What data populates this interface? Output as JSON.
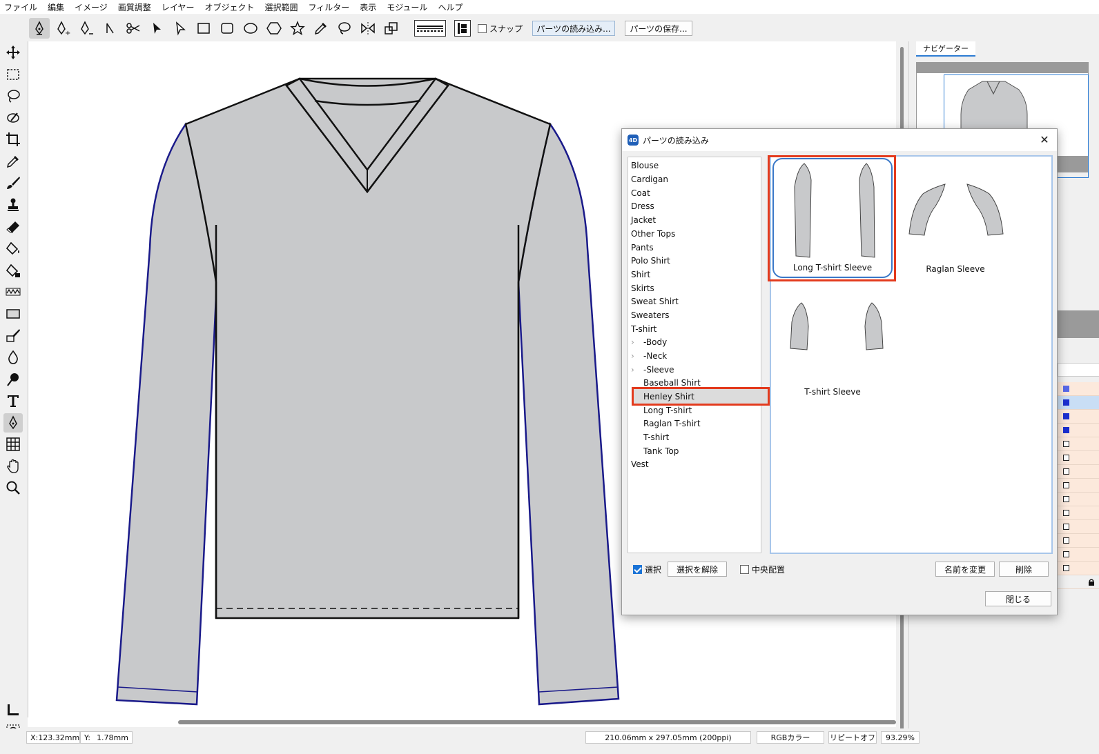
{
  "menu": [
    "ファイル",
    "編集",
    "イメージ",
    "画質調整",
    "レイヤー",
    "オブジェクト",
    "選択範囲",
    "フィルター",
    "表示",
    "モジュール",
    "ヘルプ"
  ],
  "toolbar": {
    "snap_label": "スナップ",
    "load_parts_label": "パーツの読み込み...",
    "save_parts_label": "パーツの保存..."
  },
  "navigator": {
    "tab_label": "ナビゲーター"
  },
  "status": {
    "x_label": "X:",
    "x_value": "123.32mm",
    "y_label": "Y:",
    "y_value": "1.78mm",
    "doc_size": "210.06mm x 297.05mm (200ppi)",
    "color_mode": "RGBカラー",
    "repeat": "リピートオフ",
    "zoom": "93.29%"
  },
  "dialog": {
    "title": "パーツの読み込み",
    "logo_text": "4D",
    "categories": [
      {
        "label": "Blouse",
        "level": 0
      },
      {
        "label": "Cardigan",
        "level": 0
      },
      {
        "label": "Coat",
        "level": 0
      },
      {
        "label": "Dress",
        "level": 0
      },
      {
        "label": "Jacket",
        "level": 0
      },
      {
        "label": "Other Tops",
        "level": 0
      },
      {
        "label": "Pants",
        "level": 0
      },
      {
        "label": "Polo Shirt",
        "level": 0
      },
      {
        "label": "Shirt",
        "level": 0
      },
      {
        "label": "Skirts",
        "level": 0
      },
      {
        "label": "Sweat Shirt",
        "level": 0
      },
      {
        "label": "Sweaters",
        "level": 0
      },
      {
        "label": "T-shirt",
        "level": 0
      },
      {
        "label": "-Body",
        "level": 1
      },
      {
        "label": "-Neck",
        "level": 1
      },
      {
        "label": "-Sleeve",
        "level": 1
      },
      {
        "label": "Baseball Shirt",
        "level": 1
      },
      {
        "label": "Henley Shirt",
        "level": 1
      },
      {
        "label": "Long T-shirt",
        "level": 1
      },
      {
        "label": "Raglan T-shirt",
        "level": 1
      },
      {
        "label": "T-shirt",
        "level": 1
      },
      {
        "label": "Tank Top",
        "level": 1
      },
      {
        "label": "Vest",
        "level": 0
      }
    ],
    "selected_category": "-Sleeve",
    "parts": [
      {
        "label": "Long T-shirt Sleeve",
        "selected": true
      },
      {
        "label": "Raglan Sleeve",
        "selected": false
      },
      {
        "label": "T-shirt Sleeve",
        "selected": false
      }
    ],
    "select_label": "選択",
    "deselect_label": "選択を解除",
    "center_label": "中央配置",
    "rename_label": "名前を変更",
    "delete_label": "削除",
    "close_label": "閉じる"
  },
  "colors": {
    "accent": "#1a73d6",
    "highlight": "#e33a1d",
    "garment_fill": "#c8c9cb",
    "seam_blue": "#1a1a8a"
  }
}
